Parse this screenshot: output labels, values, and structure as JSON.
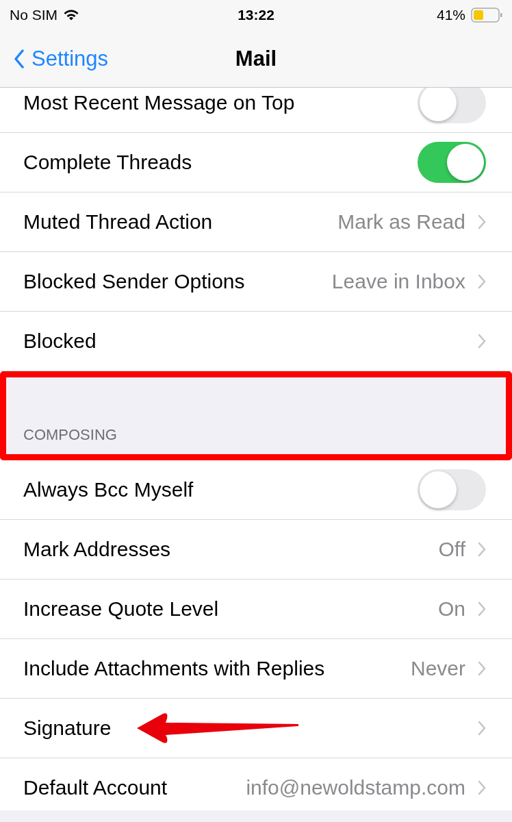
{
  "status_bar": {
    "carrier": "No SIM",
    "time": "13:22",
    "battery": "41%"
  },
  "nav": {
    "back": "Settings",
    "title": "Mail"
  },
  "sections": [
    {
      "rows": [
        {
          "kind": "toggle",
          "label": "Most Recent Message on Top",
          "on": false
        },
        {
          "kind": "toggle",
          "label": "Complete Threads",
          "on": true
        },
        {
          "kind": "link",
          "label": "Muted Thread Action",
          "value": "Mark as Read"
        },
        {
          "kind": "link",
          "label": "Blocked Sender Options",
          "value": "Leave in Inbox"
        },
        {
          "kind": "link",
          "label": "Blocked"
        }
      ]
    },
    {
      "header": "COMPOSING",
      "highlighted": true,
      "rows": [
        {
          "kind": "toggle",
          "label": "Always Bcc Myself",
          "on": false
        },
        {
          "kind": "link",
          "label": "Mark Addresses",
          "value": "Off"
        },
        {
          "kind": "link",
          "label": "Increase Quote Level",
          "value": "On"
        },
        {
          "kind": "link",
          "label": "Include Attachments with Replies",
          "value": "Never"
        },
        {
          "kind": "link",
          "label": "Signature",
          "pointed": true
        },
        {
          "kind": "link",
          "label": "Default Account",
          "value": "info@newoldstamp.com"
        }
      ]
    }
  ]
}
